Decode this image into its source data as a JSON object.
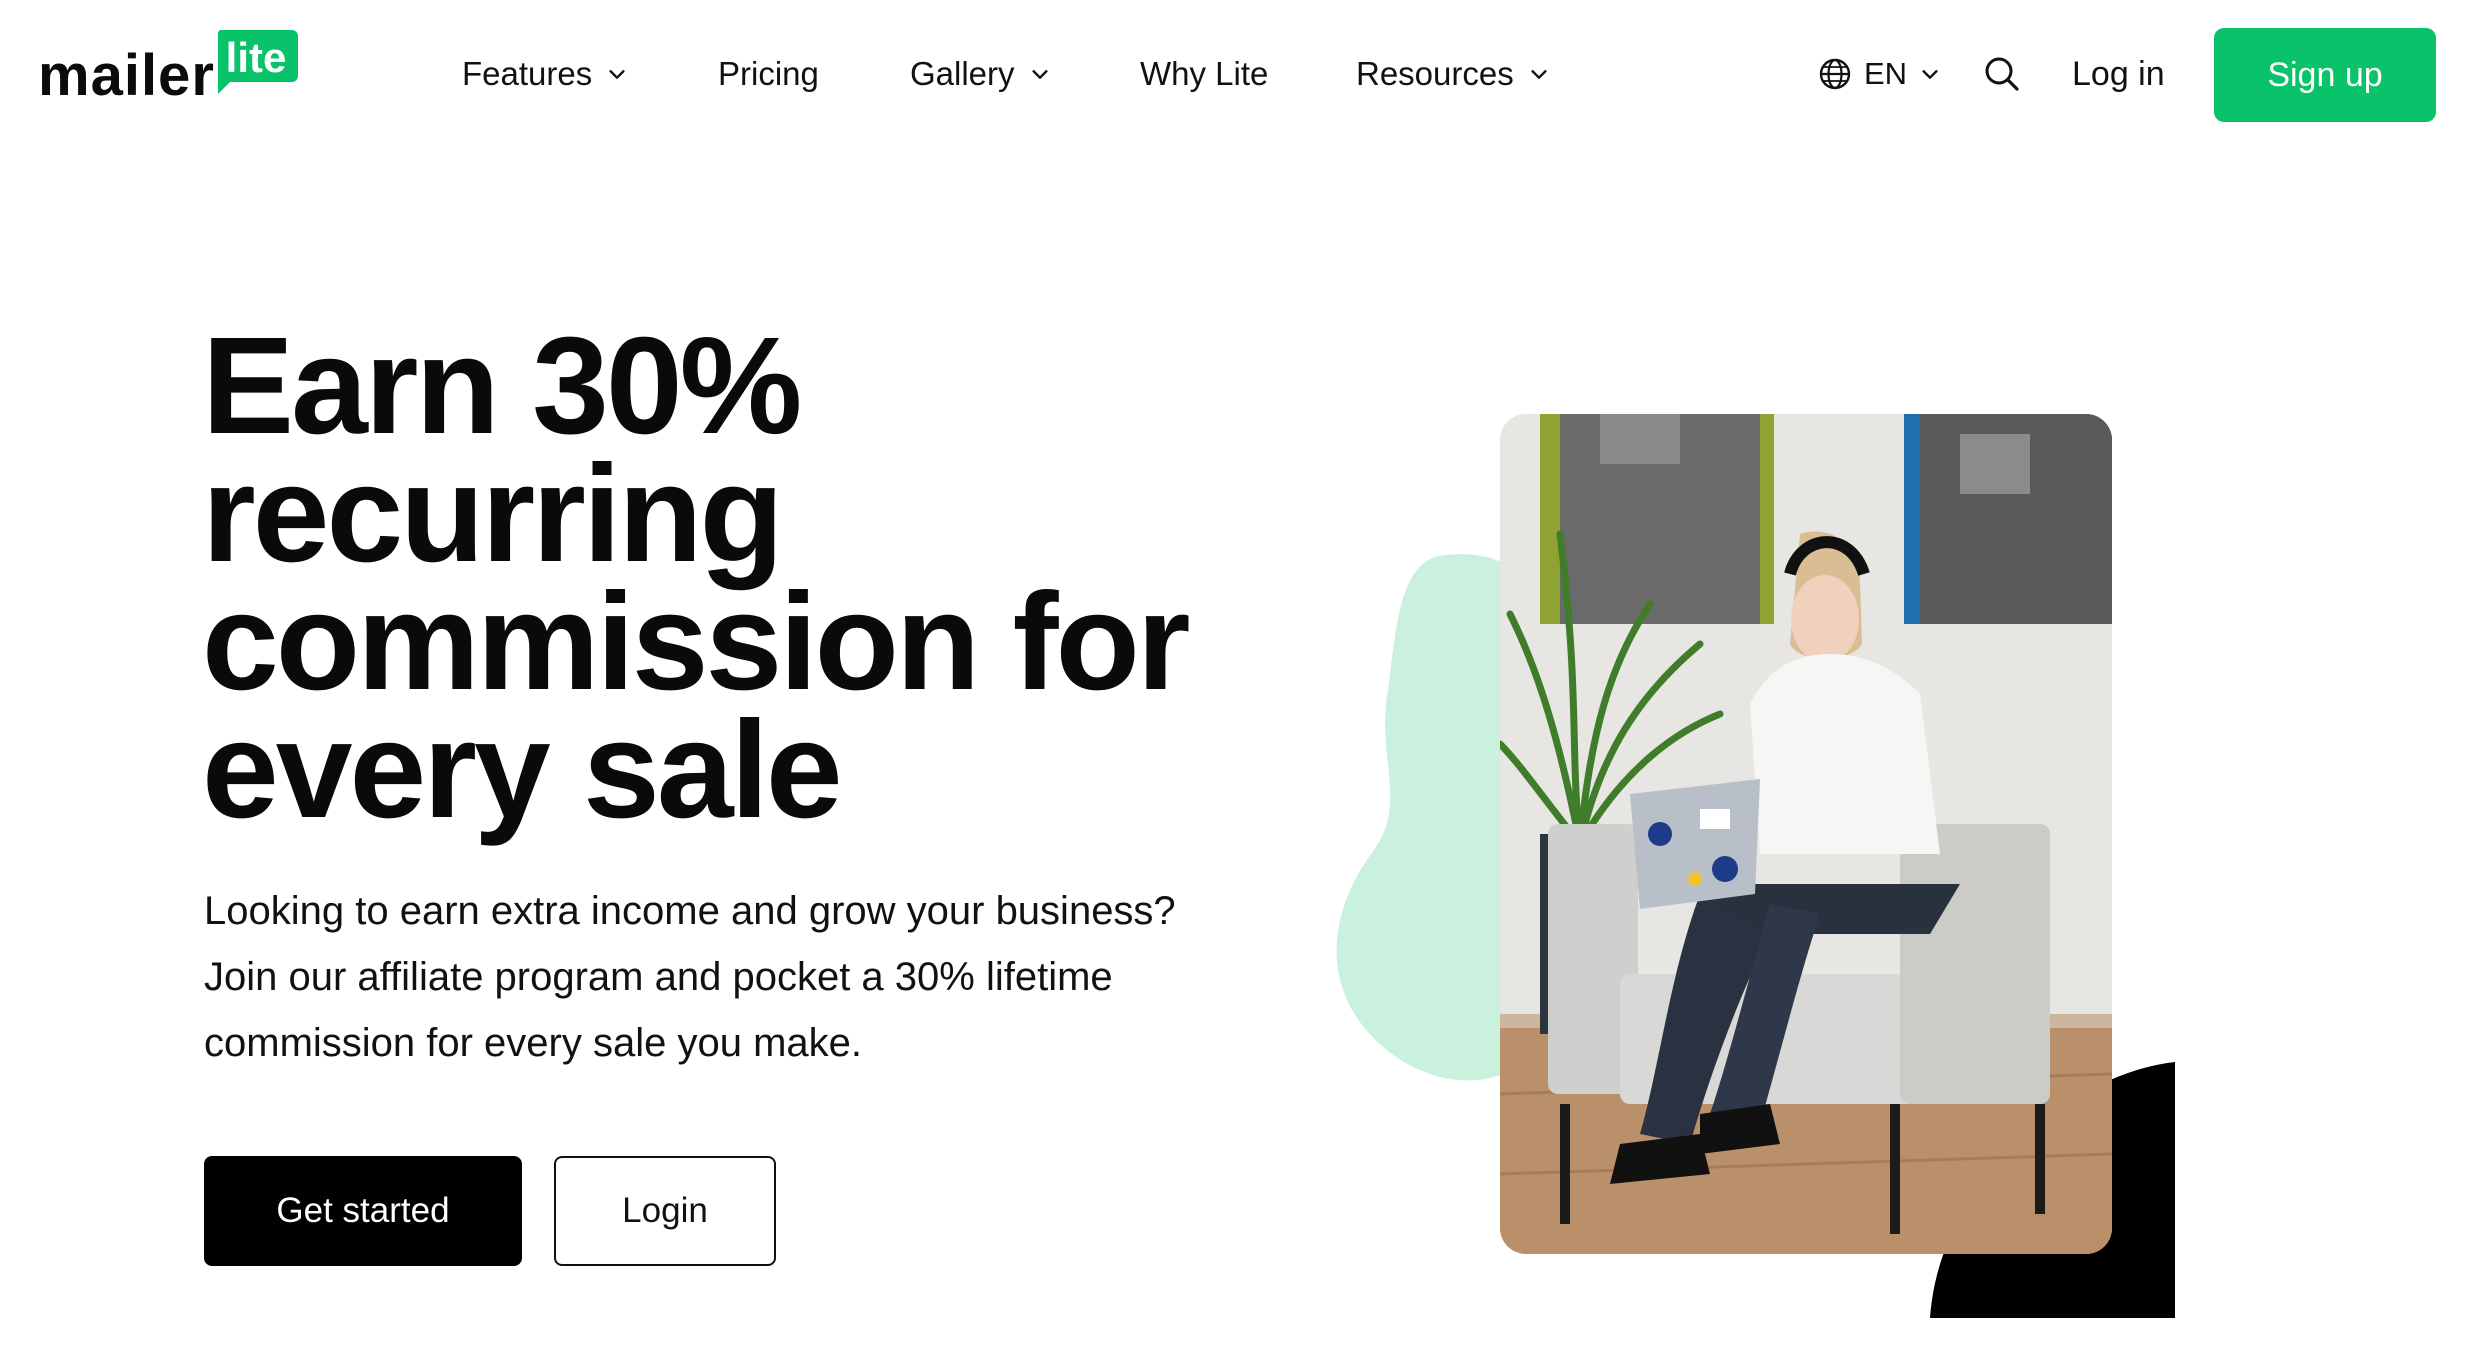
{
  "brand": {
    "wordmark": "mailer",
    "badge": "lite",
    "accent_color": "#09c269",
    "mint_color": "#c9f1de"
  },
  "nav": {
    "items": [
      {
        "label": "Features",
        "has_dropdown": true
      },
      {
        "label": "Pricing",
        "has_dropdown": false
      },
      {
        "label": "Gallery",
        "has_dropdown": true
      },
      {
        "label": "Why Lite",
        "has_dropdown": false
      },
      {
        "label": "Resources",
        "has_dropdown": true
      }
    ],
    "language": "EN",
    "login": "Log in",
    "signup": "Sign up"
  },
  "hero": {
    "title": "Earn 30% recurring commission for every sale",
    "subtitle": "Looking to earn extra income and grow your business? Join our affiliate program and pocket a 30% lifetime commission for every sale you make.",
    "primary_cta": "Get started",
    "secondary_cta": "Login"
  },
  "icons": {
    "globe": "globe-icon",
    "search": "search-icon",
    "chevron": "chevron-down-icon"
  }
}
